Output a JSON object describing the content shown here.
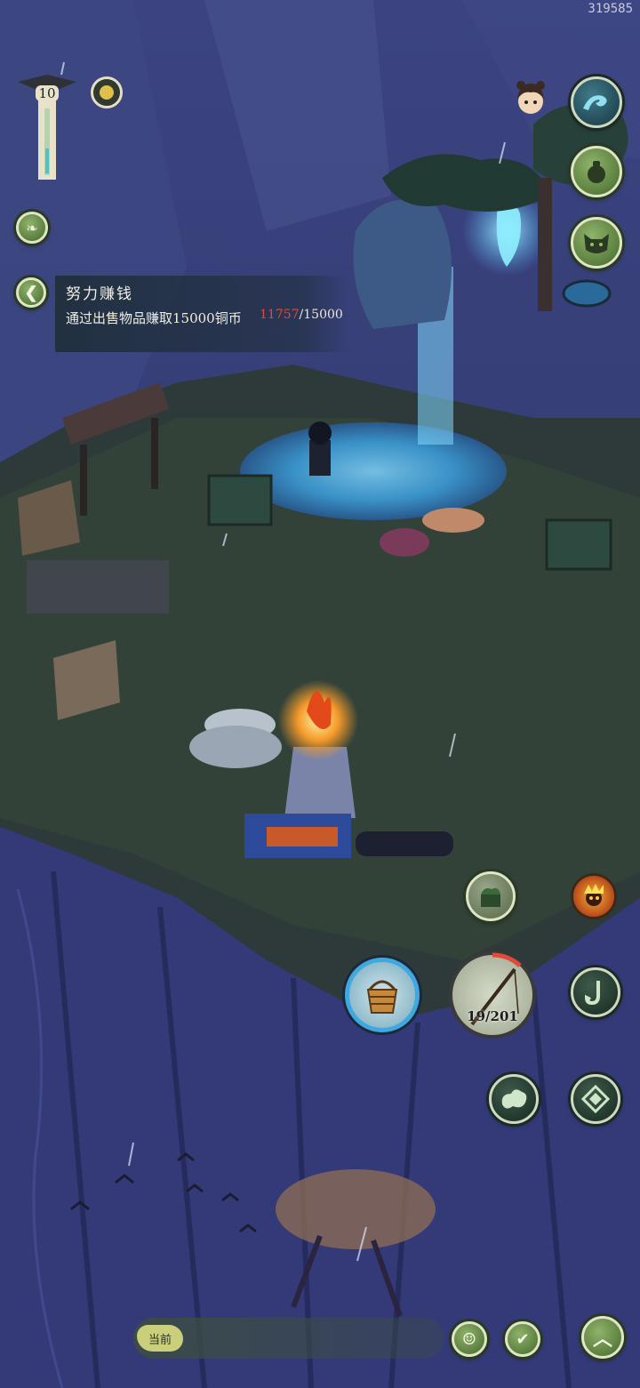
{
  "watermark": "319585",
  "level": "10",
  "quest": {
    "title": "努力赚钱",
    "description": "通过出售物品赚取15000铜币",
    "progress_current": "11757",
    "progress_total": "/15000"
  },
  "tool": {
    "durability": "19/201"
  },
  "bottom": {
    "current_label": "当前"
  },
  "colors": {
    "accent_green": "#6f9450",
    "progress_red": "#e04a3a",
    "sky": "#2b3160",
    "pond": "#2f8fd6"
  },
  "icons": {
    "top_left": [
      "incense-meter-icon",
      "orb-icon",
      "leaf-icon",
      "back-arrow-icon"
    ],
    "right_column": [
      "character-portrait-icon",
      "wave-icon",
      "gourd-icon",
      "demon-mask-icon"
    ],
    "action_buttons": [
      "cloud-box-icon",
      "fire-spirit-icon",
      "bucket-icon",
      "fishing-rod-icon",
      "hook-icon",
      "swirl-cloud-icon",
      "compass-icon"
    ],
    "bottom": [
      "smile-emote-icon",
      "check-chat-icon",
      "expand-up-icon"
    ]
  }
}
